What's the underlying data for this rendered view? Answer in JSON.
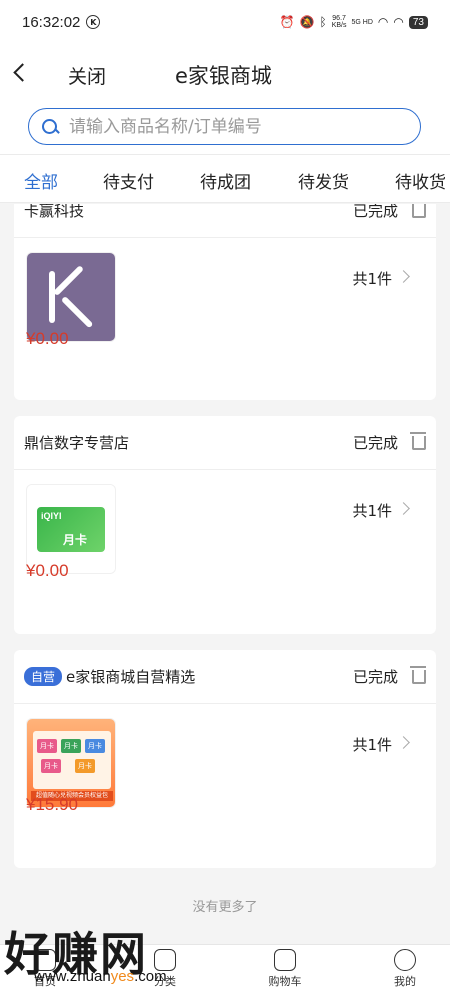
{
  "status_bar": {
    "time": "16:32:02",
    "k_badge": "K",
    "net_speed_top": "96.7",
    "net_speed_bottom": "KB/s",
    "net_label": "5G HD",
    "battery": "73"
  },
  "header": {
    "close_label": "关闭",
    "title": "e家银商城"
  },
  "search": {
    "placeholder": "请输入商品名称/订单编号"
  },
  "tabs": [
    {
      "label": "全部",
      "active": true
    },
    {
      "label": "待支付",
      "active": false
    },
    {
      "label": "待成团",
      "active": false
    },
    {
      "label": "待发货",
      "active": false
    },
    {
      "label": "待收货",
      "active": false
    }
  ],
  "orders": [
    {
      "shop": "卡赢科技",
      "status": "已完成",
      "count": "共1件",
      "price": "¥0.00",
      "thumb_icon": "keep-logo-icon"
    },
    {
      "shop": "鼎信数字专营店",
      "status": "已完成",
      "count": "共1件",
      "price": "¥0.00",
      "thumb_icon": "iqiyi-month-card-icon",
      "thumb_text": "iQIYI",
      "thumb_sub": "月卡"
    },
    {
      "badge": "自营",
      "shop": "e家银商城自营精选",
      "status": "已完成",
      "count": "共1件",
      "price": "¥15.90",
      "thumb_icon": "membership-bundle-icon",
      "thumb_text": "超值随心兑视频会员权益包"
    }
  ],
  "no_more": "没有更多了",
  "bottom_nav": [
    {
      "label": "首页",
      "icon": "home-icon"
    },
    {
      "label": "分类",
      "icon": "category-icon"
    },
    {
      "label": "购物车",
      "icon": "cart-icon"
    },
    {
      "label": "我的",
      "icon": "profile-icon"
    }
  ],
  "watermark": {
    "text": "好赚网",
    "url_prefix": "www.zhuan",
    "url_highlight": "yes",
    "url_suffix": ".com"
  },
  "colors": {
    "accent": "#2f6fd0",
    "price": "#d63b2a",
    "badge": "#3a6fd8"
  }
}
